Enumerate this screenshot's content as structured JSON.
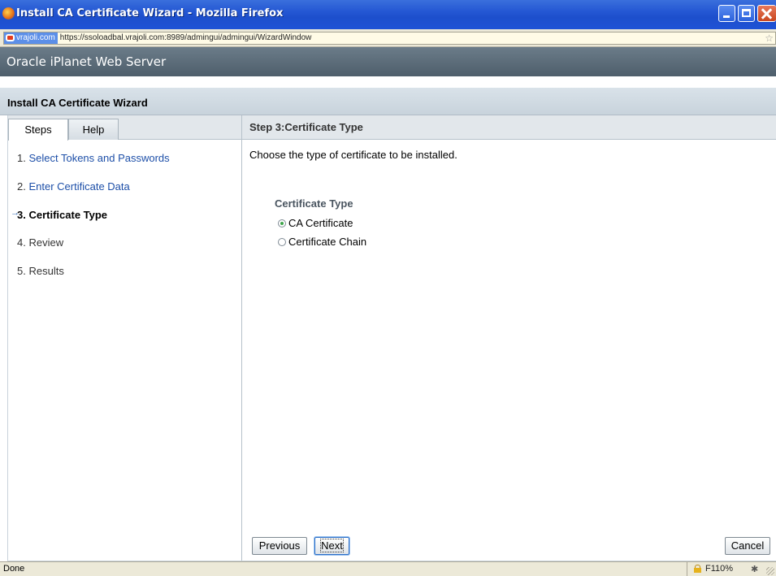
{
  "window": {
    "title": "Install CA Certificate Wizard - Mozilla Firefox",
    "app_icon": "firefox-icon",
    "controls": [
      "minimize-icon",
      "maximize-icon",
      "close-icon"
    ]
  },
  "urlbar": {
    "site_label": "vrajoli.com",
    "url": "https://ssoloadbal.vrajoli.com:8989/admingui/admingui/WizardWindow",
    "bookmark_icon": "star-icon"
  },
  "product": {
    "name": "Oracle iPlanet Web Server"
  },
  "wizard": {
    "title": "Install CA Certificate Wizard"
  },
  "tabs": [
    {
      "label": "Steps",
      "active": true
    },
    {
      "label": "Help",
      "active": false
    }
  ],
  "steps": [
    {
      "number": "1.",
      "label": "Select Tokens and Passwords",
      "state": "link"
    },
    {
      "number": "2.",
      "label": "Enter Certificate Data",
      "state": "link"
    },
    {
      "number": "3.",
      "label": "Certificate Type",
      "state": "current"
    },
    {
      "number": "4.",
      "label": "Review",
      "state": "pending"
    },
    {
      "number": "5.",
      "label": "Results",
      "state": "pending"
    }
  ],
  "current_step_arrow": "→",
  "main": {
    "header": "Step 3:Certificate Type",
    "instructions": "Choose the type of certificate to be installed.",
    "group_label": "Certificate Type",
    "options": [
      {
        "label": "CA Certificate",
        "checked": true
      },
      {
        "label": "Certificate Chain",
        "checked": false
      }
    ]
  },
  "buttons": {
    "previous": "Previous",
    "next": "Next",
    "cancel": "Cancel"
  },
  "statusbar": {
    "status": "Done",
    "zoom": "F110%",
    "lock_icon": "padlock-icon",
    "ext_icon": "addon-icon"
  },
  "colors": {
    "titlebar": "#2457d3",
    "product_header": "#5a6a77",
    "link": "#1d4fa8",
    "radio_selected": "#3ea44a"
  }
}
